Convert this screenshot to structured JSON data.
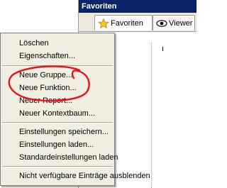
{
  "panel": {
    "title": "Favoriten",
    "tabs": [
      {
        "label": "Favoriten",
        "icon": "star-icon"
      },
      {
        "label": "Viewer",
        "icon": "eye-icon"
      }
    ]
  },
  "menu": {
    "items": [
      {
        "label": "Löschen"
      },
      {
        "label": "Eigenschaften..."
      },
      {
        "label": "Neue Gruppe..."
      },
      {
        "label": "Neue Funktion..."
      },
      {
        "label": "Neuer Report..."
      },
      {
        "label": "Neuer Kontextbaum..."
      },
      {
        "label": "Einstellungen speichern..."
      },
      {
        "label": "Einstellungen laden..."
      },
      {
        "label": "Standardeinstellungen laden"
      },
      {
        "label": "Nicht verfügbare Einträge ausblenden"
      }
    ]
  },
  "colors": {
    "title_bar": "#0a246a",
    "menu_bg": "#f1efe2",
    "annotation": "#e8141a"
  }
}
